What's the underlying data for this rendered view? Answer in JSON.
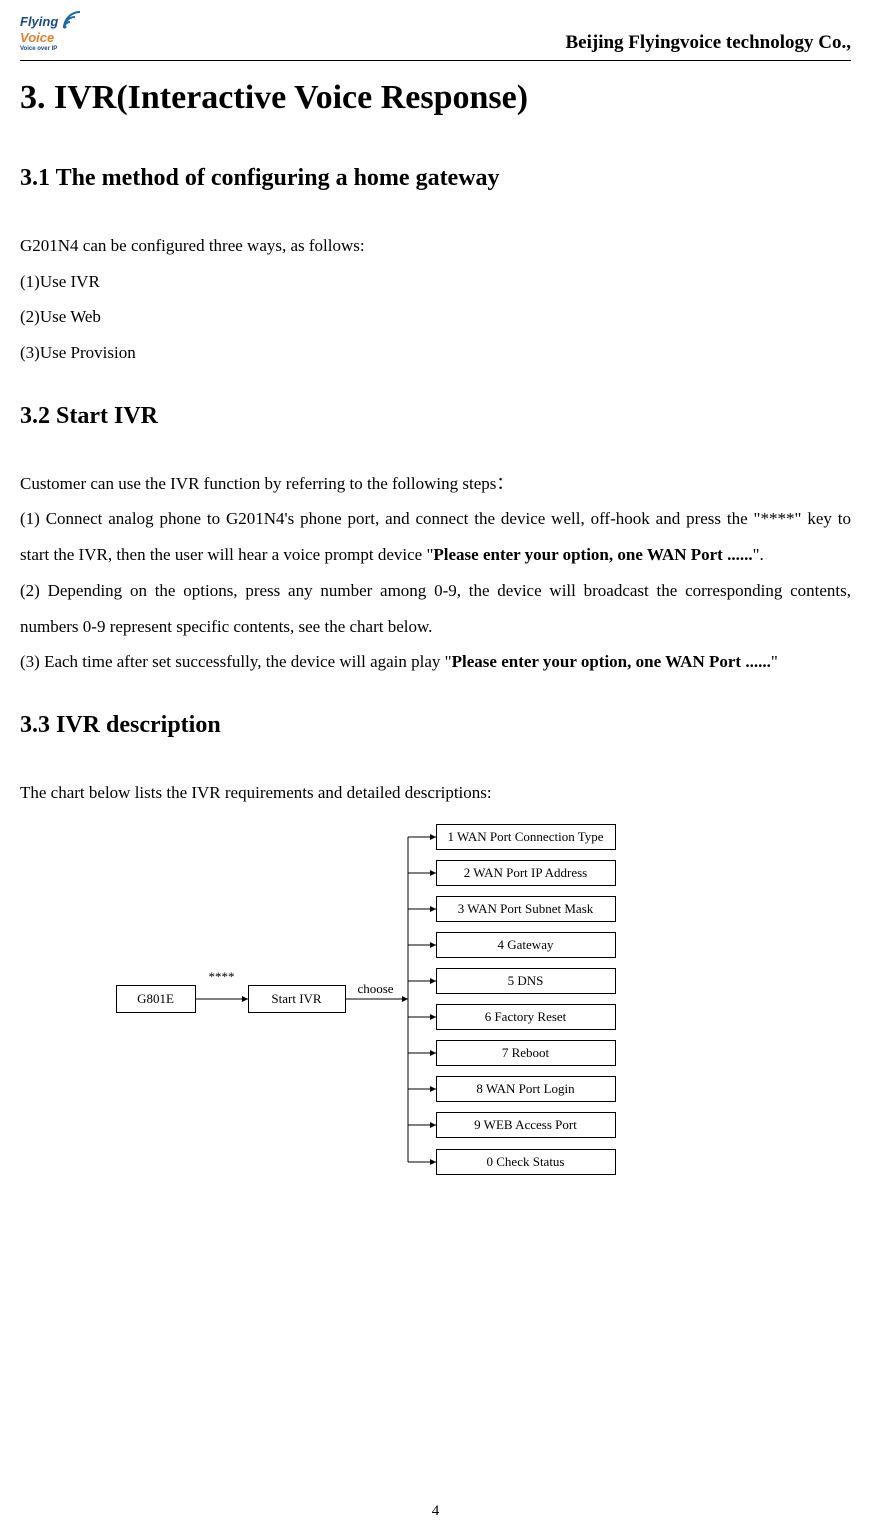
{
  "header": {
    "logo": {
      "line1": "Flying",
      "line2": "Voice",
      "tagline": "Voice over IP"
    },
    "company": "Beijing Flyingvoice technology Co.,"
  },
  "title": "3. IVR(Interactive Voice Response)",
  "section31": {
    "heading": "3.1 The method of configuring a home gateway",
    "intro": "G201N4 can be configured three ways, as follows:",
    "items": [
      "(1)Use IVR",
      "(2)Use Web",
      "(3)Use Provision"
    ]
  },
  "section32": {
    "heading": "3.2 Start IVR",
    "intro": "Customer can use the IVR function by referring to the following steps：",
    "p1_a": "(1) Connect analog phone to G201N4's phone port, and connect the device well, off-hook and press the \"****\" key to start the IVR, then the user will hear a voice prompt device \"",
    "p1_b": "Please enter your option, one WAN Port ......",
    "p1_c": "\".",
    "p2": "(2) Depending on the options, press any number among 0-9, the device will broadcast the corresponding contents, numbers 0-9 represent specific contents, see the chart below.",
    "p3_a": "(3) Each time after set successfully, the device will again play \"",
    "p3_b": "Please enter your option, one WAN Port ......",
    "p3_c": "\""
  },
  "section33": {
    "heading": "3.3    IVR description",
    "intro": "The chart below lists the IVR requirements and detailed descriptions:"
  },
  "diagram": {
    "left_box": "G801E",
    "arrow1_label": "****",
    "mid_box": "Start   IVR",
    "arrow2_label": "choose",
    "options": [
      "1 WAN Port Connection Type",
      "2 WAN Port IP Address",
      "3  WAN Port Subnet Mask",
      "4 Gateway",
      "5 DNS",
      "6 Factory Reset",
      "7 Reboot",
      "8  WAN Port Login",
      "9 WEB Access Port",
      "0 Check Status"
    ]
  },
  "page_number": "4"
}
